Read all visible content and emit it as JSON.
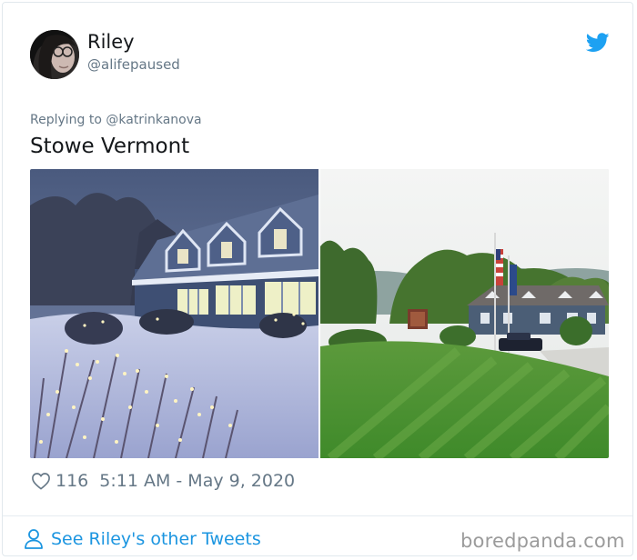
{
  "tweet": {
    "user": {
      "display_name": "Riley",
      "handle": "@alifepaused"
    },
    "replying_to": "Replying to @katrinkanova",
    "text": "Stowe Vermont",
    "likes": "116",
    "timestamp": "5:11 AM - May 9, 2020"
  },
  "footer": {
    "see_more": "See Riley's other Tweets"
  },
  "watermark": "boredpanda.com",
  "colors": {
    "twitter_blue": "#1da1f2",
    "link_blue": "#1b95e0",
    "secondary_text": "#657786",
    "primary_text": "#14171a"
  },
  "icons": {
    "brand": "twitter-bird-icon",
    "like": "heart-icon",
    "profile": "person-icon"
  }
}
